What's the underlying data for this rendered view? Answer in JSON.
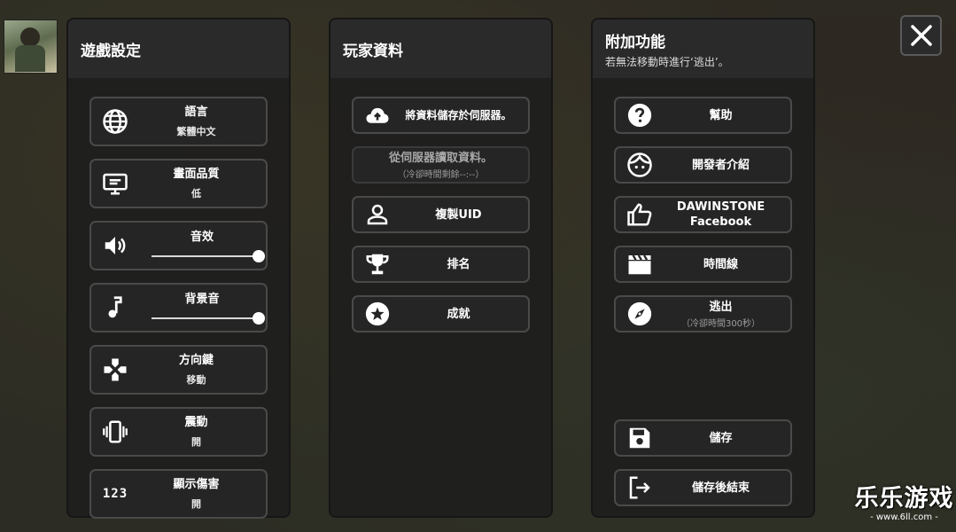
{
  "game_settings": {
    "title": "遊戲設定",
    "language": {
      "label": "語言",
      "value": "繁體中文"
    },
    "quality": {
      "label": "畫面品質",
      "value": "低"
    },
    "sound": {
      "label": "音效",
      "level": 1.0
    },
    "music": {
      "label": "背景音",
      "level": 1.0
    },
    "dpad": {
      "label": "方向鍵",
      "value": "移動"
    },
    "vibration": {
      "label": "震動",
      "value": "開"
    },
    "damage": {
      "label": "顯示傷害",
      "value": "開",
      "icon_text": "123"
    }
  },
  "player_data": {
    "title": "玩家資料",
    "save_server": {
      "label": "將資料儲存於伺服器。"
    },
    "load_server": {
      "label": "從伺服器讀取資料。",
      "sub": "（冷卻時間剩餘--:--）"
    },
    "copy_uid": {
      "label": "複製UID"
    },
    "ranking": {
      "label": "排名"
    },
    "achievements": {
      "label": "成就"
    }
  },
  "extra": {
    "title": "附加功能",
    "subtitle": "若無法移動時進行‘逃出’。",
    "help": {
      "label": "幫助"
    },
    "developer": {
      "label": "開發者介紹"
    },
    "facebook": {
      "line1": "DAWINSTONE",
      "line2": "Facebook"
    },
    "timeline": {
      "label": "時間線"
    },
    "escape": {
      "label": "逃出",
      "sub": "（冷卻時間300秒）"
    },
    "save": {
      "label": "儲存"
    },
    "save_quit": {
      "label": "儲存後結束"
    }
  },
  "watermark": {
    "title": "乐乐游戏",
    "url": "- www.6ll.com -"
  },
  "icons": {
    "close": "close-icon",
    "avatar": "player-avatar",
    "language": "globe-icon",
    "quality": "monitor-settings-icon",
    "sound": "speaker-icon",
    "music": "music-note-icon",
    "dpad": "dpad-icon",
    "vibration": "vibration-icon",
    "damage": "numbers-123-icon",
    "upload": "cloud-upload-icon",
    "person": "person-icon",
    "trophy": "trophy-icon",
    "star": "star-circle-icon",
    "help": "help-circle-icon",
    "face": "face-icon",
    "thumb": "thumb-up-icon",
    "clapper": "clapperboard-icon",
    "compass": "compass-icon",
    "floppy": "floppy-disk-icon",
    "exit": "exit-icon"
  },
  "colors": {
    "panel": "#1e1e1e",
    "button": "#252525",
    "button_border": "#4a4a4a",
    "text": "#ffffff",
    "muted": "#9c9c9c"
  }
}
